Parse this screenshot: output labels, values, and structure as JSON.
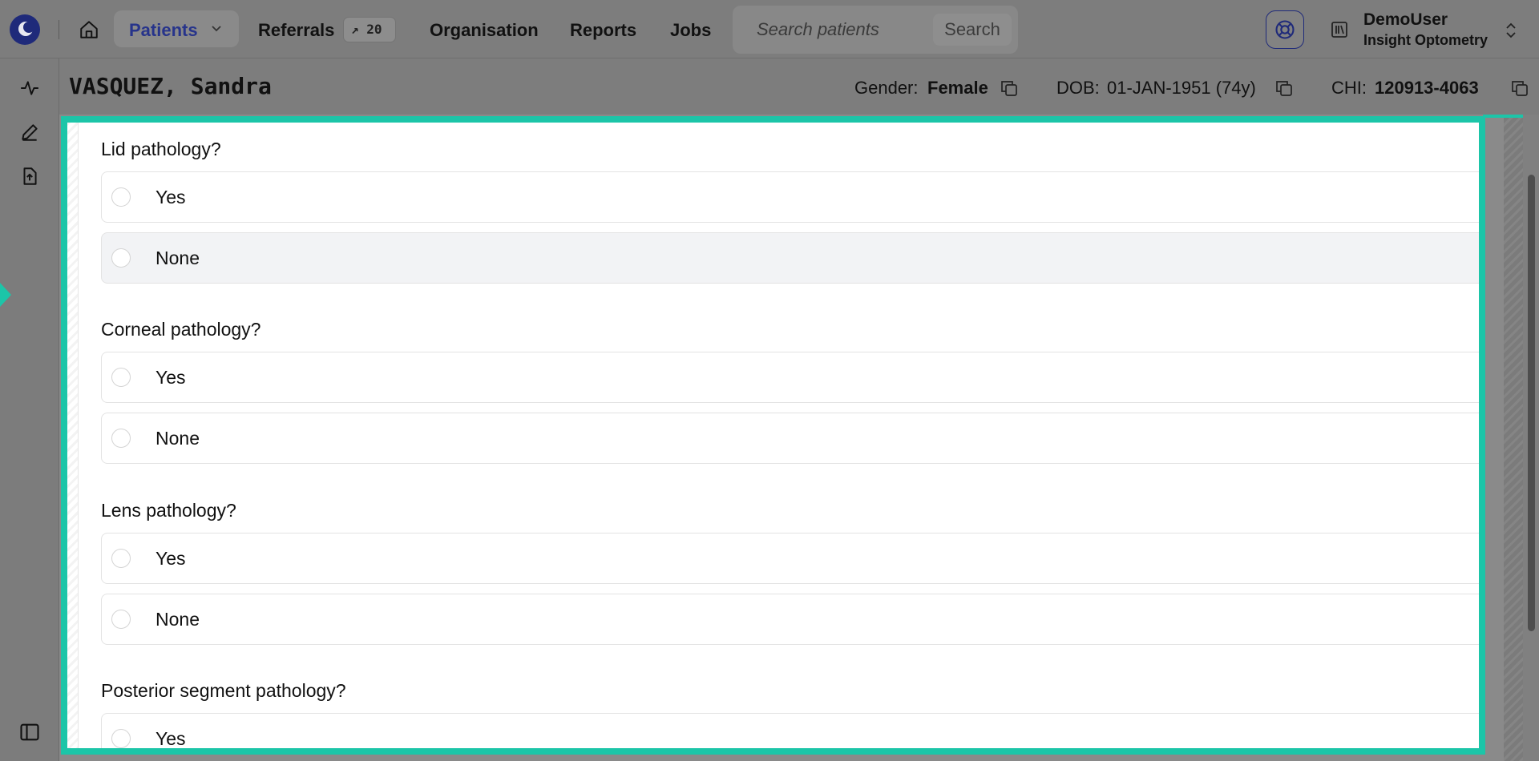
{
  "nav": {
    "patients": "Patients",
    "referrals": "Referrals",
    "referrals_badge": "↗ 20",
    "organisation": "Organisation",
    "reports": "Reports",
    "jobs": "Jobs",
    "search_placeholder": "Search patients",
    "search_button": "Search"
  },
  "user": {
    "name": "DemoUser",
    "org": "Insight Optometry"
  },
  "patient": {
    "name": "VASQUEZ, Sandra",
    "gender_label": "Gender:",
    "gender": "Female",
    "dob_label": "DOB:",
    "dob": "01-JAN-1951 (74y)",
    "chi_label": "CHI:",
    "chi": "120913-4063"
  },
  "form": {
    "questions": [
      {
        "label": "Lid pathology?",
        "options": [
          "Yes",
          "None"
        ]
      },
      {
        "label": "Corneal pathology?",
        "options": [
          "Yes",
          "None"
        ]
      },
      {
        "label": "Lens pathology?",
        "options": [
          "Yes",
          "None"
        ]
      },
      {
        "label": "Posterior segment pathology?",
        "options": [
          "Yes"
        ]
      }
    ]
  },
  "colors": {
    "accent": "#1cc5a8",
    "brand": "#27348b"
  },
  "icons": {
    "logo": "eye-logo-icon",
    "home": "home-icon",
    "help": "lifebuoy-icon",
    "org": "library-icon",
    "copy": "copy-icon",
    "activity": "activity-icon",
    "edit": "pencil-icon",
    "upload": "file-upload-icon",
    "sidebar_toggle": "sidebar-toggle-icon"
  }
}
